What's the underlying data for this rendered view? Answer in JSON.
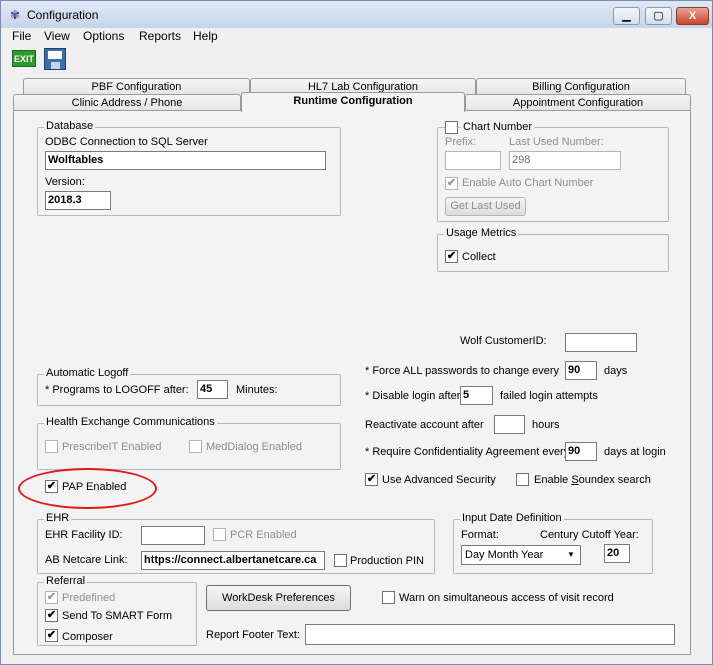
{
  "window": {
    "title": "Configuration",
    "controls": {
      "min": "▭",
      "max": "□",
      "close": "X"
    }
  },
  "menu": [
    "File",
    "View",
    "Options",
    "Reports",
    "Help"
  ],
  "toolbar": {
    "exit_label": "EXIT"
  },
  "tabs": {
    "row1": [
      "PBF Configuration",
      "HL7 Lab Configuration",
      "Billing Configuration"
    ],
    "row2": [
      "Clinic Address / Phone",
      "Runtime Configuration",
      "Appointment Configuration"
    ]
  },
  "database": {
    "title": "Database",
    "odbc_label": "ODBC Connection to SQL Server",
    "odbc_value": "Wolftables",
    "version_label": "Version:",
    "version_value": "2018.3"
  },
  "chart_number": {
    "title": "Chart Number",
    "prefix_label": "Prefix:",
    "prefix_value": "",
    "last_used_label": "Last Used Number:",
    "last_used_value": "298",
    "auto_label": "Enable Auto Chart Number",
    "get_last_used": "Get Last Used"
  },
  "usage_metrics": {
    "title": "Usage Metrics",
    "collect_label": "Collect"
  },
  "wolf_customer_id": {
    "label": "Wolf CustomerID:",
    "value": ""
  },
  "auto_logoff": {
    "title": "Automatic Logoff",
    "programs_label": "* Programs to LOGOFF after:",
    "programs_value": "45",
    "minutes_label": "Minutes:"
  },
  "security": {
    "force_label": "* Force ALL passwords to change every",
    "force_value": "90",
    "force_unit": "days",
    "disable_label": "* Disable login after",
    "disable_value": "5",
    "disable_unit": "failed login attempts",
    "reactivate_label": "Reactivate account after",
    "reactivate_value": "",
    "reactivate_unit": "hours",
    "confidentiality_label": "* Require Confidentiality Agreement every",
    "confidentiality_value": "90",
    "confidentiality_unit": "days at login",
    "advanced_security_label": "Use Advanced Security",
    "soundex_label_pre": "Enable ",
    "soundex_label_u": "S",
    "soundex_label_post": "oundex search"
  },
  "health_exchange": {
    "title": "Health Exchange Communications",
    "prescribeit": "PrescribeIT Enabled",
    "meddialog": "MedDialog Enabled"
  },
  "pap": {
    "label": "PAP Enabled"
  },
  "ehr": {
    "title": "EHR",
    "facility_label": "EHR Facility ID:",
    "facility_value": "",
    "pcr_label": "PCR Enabled",
    "netcare_label": "AB Netcare Link:",
    "netcare_value": "https://connect.albertanetcare.ca",
    "production_pin": "Production PIN"
  },
  "input_date": {
    "title": "Input Date Definition",
    "format_label": "Format:",
    "format_value": "Day Month Year",
    "century_label": "Century Cutoff Year:",
    "century_value": "20"
  },
  "referral": {
    "title": "Referral",
    "predefined": "Predefined",
    "smart_form": "Send To SMART Form",
    "composer": "Composer"
  },
  "workdesk_button": "WorkDesk Preferences",
  "warn_label": "Warn on simultaneous access of visit record",
  "report_footer": {
    "label": "Report Footer Text:",
    "value": ""
  },
  "check_glyph": "✔"
}
